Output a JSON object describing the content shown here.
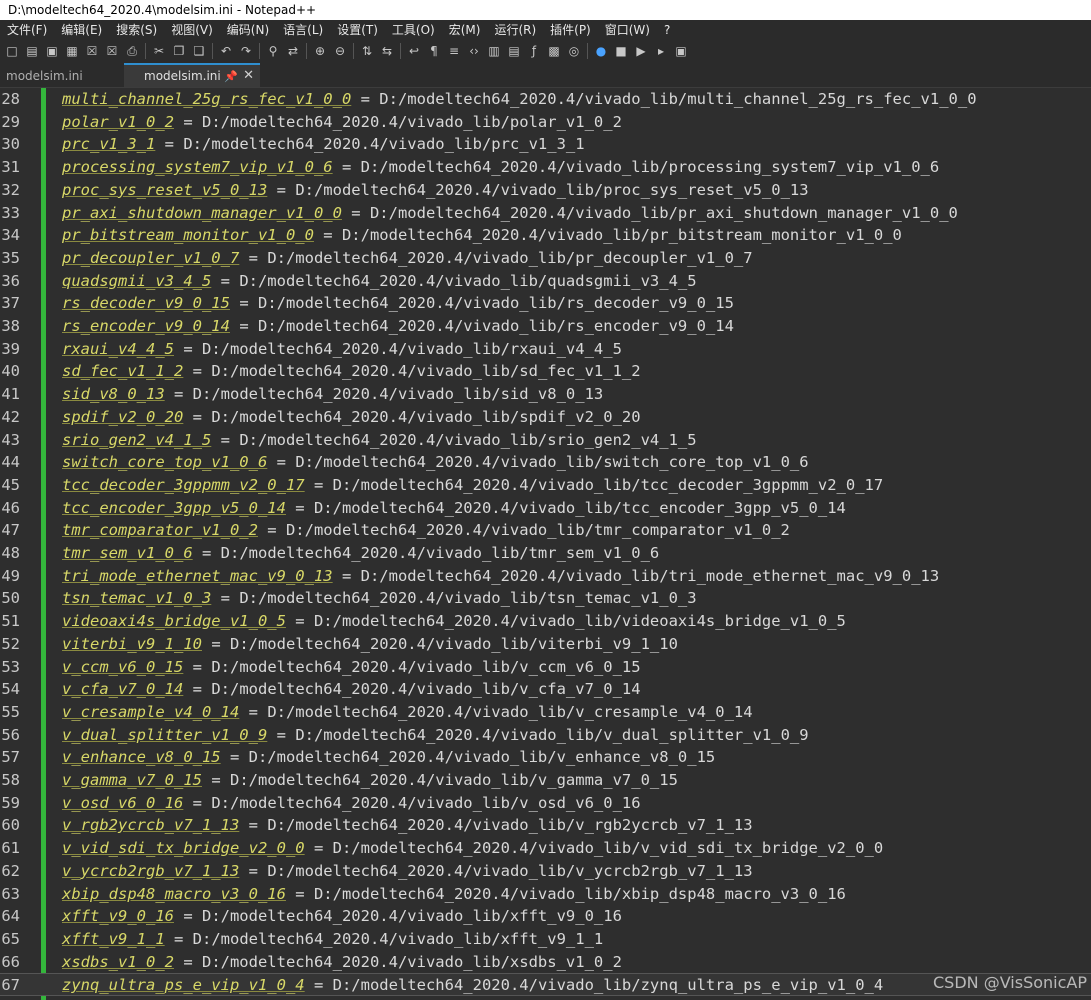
{
  "window": {
    "title": "D:\\modeltech64_2020.4\\modelsim.ini - Notepad++"
  },
  "menu": [
    "文件(F)",
    "编辑(E)",
    "搜索(S)",
    "视图(V)",
    "编码(N)",
    "语言(L)",
    "设置(T)",
    "工具(O)",
    "宏(M)",
    "运行(R)",
    "插件(P)",
    "窗口(W)",
    "?"
  ],
  "toolbar": {
    "icons": [
      "new-file-icon",
      "open-folder-icon",
      "save-icon",
      "save-all-icon",
      "close-icon",
      "close-all-icon",
      "print-icon",
      "cut-icon",
      "copy-icon",
      "paste-icon",
      "undo-icon",
      "redo-icon",
      "find-icon",
      "replace-icon",
      "zoom-in-icon",
      "zoom-out-icon",
      "sync-vertical-icon",
      "sync-horizontal-icon",
      "word-wrap-icon",
      "show-all-chars-icon",
      "indent-guide-icon",
      "user-language-icon",
      "doc-map-icon",
      "doc-list-icon",
      "function-list-icon",
      "folder-workspace-icon",
      "monitor-icon",
      "record-macro-icon",
      "stop-macro-icon",
      "play-macro-icon",
      "run-macro-multiple-icon",
      "save-macro-icon"
    ]
  },
  "tabs": [
    {
      "label": "modelsim.ini",
      "active": false
    },
    {
      "label": "modelsim.ini",
      "active": true
    }
  ],
  "editor": {
    "lines": [
      {
        "n": "28",
        "key": "multi_channel_25g_rs_fec_v1_0_0",
        "eq": " = ",
        "val": "D:/modeltech64_2020.4/vivado_lib/multi_channel_25g_rs_fec_v1_0_0"
      },
      {
        "n": "29",
        "key": "polar_v1_0_2",
        "eq": " = ",
        "val": "D:/modeltech64_2020.4/vivado_lib/polar_v1_0_2"
      },
      {
        "n": "30",
        "key": "prc_v1_3_1",
        "eq": " = ",
        "val": "D:/modeltech64_2020.4/vivado_lib/prc_v1_3_1"
      },
      {
        "n": "31",
        "key": "processing_system7_vip_v1_0_6",
        "eq": " = ",
        "val": "D:/modeltech64_2020.4/vivado_lib/processing_system7_vip_v1_0_6"
      },
      {
        "n": "32",
        "key": "proc_sys_reset_v5_0_13",
        "eq": " = ",
        "val": "D:/modeltech64_2020.4/vivado_lib/proc_sys_reset_v5_0_13"
      },
      {
        "n": "33",
        "key": "pr_axi_shutdown_manager_v1_0_0",
        "eq": " = ",
        "val": "D:/modeltech64_2020.4/vivado_lib/pr_axi_shutdown_manager_v1_0_0"
      },
      {
        "n": "34",
        "key": "pr_bitstream_monitor_v1_0_0",
        "eq": " = ",
        "val": "D:/modeltech64_2020.4/vivado_lib/pr_bitstream_monitor_v1_0_0"
      },
      {
        "n": "35",
        "key": "pr_decoupler_v1_0_7",
        "eq": " = ",
        "val": "D:/modeltech64_2020.4/vivado_lib/pr_decoupler_v1_0_7"
      },
      {
        "n": "36",
        "key": "quadsgmii_v3_4_5",
        "eq": " = ",
        "val": "D:/modeltech64_2020.4/vivado_lib/quadsgmii_v3_4_5"
      },
      {
        "n": "37",
        "key": "rs_decoder_v9_0_15",
        "eq": " = ",
        "val": "D:/modeltech64_2020.4/vivado_lib/rs_decoder_v9_0_15"
      },
      {
        "n": "38",
        "key": "rs_encoder_v9_0_14",
        "eq": " = ",
        "val": "D:/modeltech64_2020.4/vivado_lib/rs_encoder_v9_0_14"
      },
      {
        "n": "39",
        "key": "rxaui_v4_4_5",
        "eq": " = ",
        "val": "D:/modeltech64_2020.4/vivado_lib/rxaui_v4_4_5"
      },
      {
        "n": "40",
        "key": "sd_fec_v1_1_2",
        "eq": " = ",
        "val": "D:/modeltech64_2020.4/vivado_lib/sd_fec_v1_1_2"
      },
      {
        "n": "41",
        "key": "sid_v8_0_13",
        "eq": " = ",
        "val": "D:/modeltech64_2020.4/vivado_lib/sid_v8_0_13"
      },
      {
        "n": "42",
        "key": "spdif_v2_0_20",
        "eq": " = ",
        "val": "D:/modeltech64_2020.4/vivado_lib/spdif_v2_0_20"
      },
      {
        "n": "43",
        "key": "srio_gen2_v4_1_5",
        "eq": " = ",
        "val": "D:/modeltech64_2020.4/vivado_lib/srio_gen2_v4_1_5"
      },
      {
        "n": "44",
        "key": "switch_core_top_v1_0_6",
        "eq": " = ",
        "val": "D:/modeltech64_2020.4/vivado_lib/switch_core_top_v1_0_6"
      },
      {
        "n": "45",
        "key": "tcc_decoder_3gppmm_v2_0_17",
        "eq": " = ",
        "val": "D:/modeltech64_2020.4/vivado_lib/tcc_decoder_3gppmm_v2_0_17"
      },
      {
        "n": "46",
        "key": "tcc_encoder_3gpp_v5_0_14",
        "eq": " = ",
        "val": "D:/modeltech64_2020.4/vivado_lib/tcc_encoder_3gpp_v5_0_14"
      },
      {
        "n": "47",
        "key": "tmr_comparator_v1_0_2",
        "eq": " = ",
        "val": "D:/modeltech64_2020.4/vivado_lib/tmr_comparator_v1_0_2"
      },
      {
        "n": "48",
        "key": "tmr_sem_v1_0_6",
        "eq": " = ",
        "val": "D:/modeltech64_2020.4/vivado_lib/tmr_sem_v1_0_6"
      },
      {
        "n": "49",
        "key": "tri_mode_ethernet_mac_v9_0_13",
        "eq": " = ",
        "val": "D:/modeltech64_2020.4/vivado_lib/tri_mode_ethernet_mac_v9_0_13"
      },
      {
        "n": "50",
        "key": "tsn_temac_v1_0_3",
        "eq": " = ",
        "val": "D:/modeltech64_2020.4/vivado_lib/tsn_temac_v1_0_3"
      },
      {
        "n": "51",
        "key": "videoaxi4s_bridge_v1_0_5",
        "eq": " = ",
        "val": "D:/modeltech64_2020.4/vivado_lib/videoaxi4s_bridge_v1_0_5"
      },
      {
        "n": "52",
        "key": "viterbi_v9_1_10",
        "eq": " = ",
        "val": "D:/modeltech64_2020.4/vivado_lib/viterbi_v9_1_10"
      },
      {
        "n": "53",
        "key": "v_ccm_v6_0_15",
        "eq": " = ",
        "val": "D:/modeltech64_2020.4/vivado_lib/v_ccm_v6_0_15"
      },
      {
        "n": "54",
        "key": "v_cfa_v7_0_14",
        "eq": " = ",
        "val": "D:/modeltech64_2020.4/vivado_lib/v_cfa_v7_0_14"
      },
      {
        "n": "55",
        "key": "v_cresample_v4_0_14",
        "eq": " = ",
        "val": "D:/modeltech64_2020.4/vivado_lib/v_cresample_v4_0_14"
      },
      {
        "n": "56",
        "key": "v_dual_splitter_v1_0_9",
        "eq": " = ",
        "val": "D:/modeltech64_2020.4/vivado_lib/v_dual_splitter_v1_0_9"
      },
      {
        "n": "57",
        "key": "v_enhance_v8_0_15",
        "eq": " = ",
        "val": "D:/modeltech64_2020.4/vivado_lib/v_enhance_v8_0_15"
      },
      {
        "n": "58",
        "key": "v_gamma_v7_0_15",
        "eq": " = ",
        "val": "D:/modeltech64_2020.4/vivado_lib/v_gamma_v7_0_15"
      },
      {
        "n": "59",
        "key": "v_osd_v6_0_16",
        "eq": " = ",
        "val": "D:/modeltech64_2020.4/vivado_lib/v_osd_v6_0_16"
      },
      {
        "n": "60",
        "key": "v_rgb2ycrcb_v7_1_13",
        "eq": " = ",
        "val": "D:/modeltech64_2020.4/vivado_lib/v_rgb2ycrcb_v7_1_13"
      },
      {
        "n": "61",
        "key": "v_vid_sdi_tx_bridge_v2_0_0",
        "eq": " = ",
        "val": "D:/modeltech64_2020.4/vivado_lib/v_vid_sdi_tx_bridge_v2_0_0"
      },
      {
        "n": "62",
        "key": "v_ycrcb2rgb_v7_1_13",
        "eq": " = ",
        "val": "D:/modeltech64_2020.4/vivado_lib/v_ycrcb2rgb_v7_1_13"
      },
      {
        "n": "63",
        "key": "xbip_dsp48_macro_v3_0_16",
        "eq": " = ",
        "val": "D:/modeltech64_2020.4/vivado_lib/xbip_dsp48_macro_v3_0_16"
      },
      {
        "n": "64",
        "key": "xfft_v9_0_16",
        "eq": " = ",
        "val": "D:/modeltech64_2020.4/vivado_lib/xfft_v9_0_16"
      },
      {
        "n": "65",
        "key": "xfft_v9_1_1",
        "eq": " = ",
        "val": "D:/modeltech64_2020.4/vivado_lib/xfft_v9_1_1"
      },
      {
        "n": "66",
        "key": "xsdbs_v1_0_2",
        "eq": " = ",
        "val": "D:/modeltech64_2020.4/vivado_lib/xsdbs_v1_0_2"
      },
      {
        "n": "67",
        "key": "zynq_ultra_ps_e_vip_v1_0_4",
        "eq": " = ",
        "val": "D:/modeltech64_2020.4/vivado_lib/zynq_ultra_ps_e_vip_v1_0_4",
        "current": true
      }
    ]
  },
  "watermark": "CSDN @VisSonicAP",
  "colors": {
    "key": "#d8d868",
    "value": "#d8d8d8",
    "change_bar": "#34b63c",
    "background": "#2e2e2e"
  }
}
